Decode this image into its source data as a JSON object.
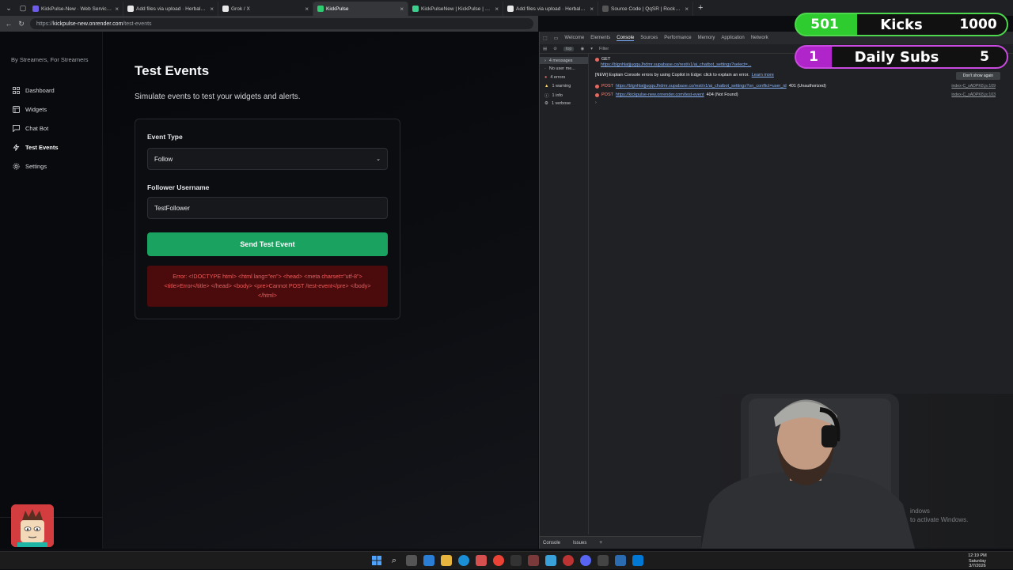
{
  "browser": {
    "tabs": [
      {
        "title": "KickPulse-New · Web Service · Re",
        "favicon_color": "#6c5ce7",
        "active": false
      },
      {
        "title": "Add files via upload · HerbalSalad",
        "favicon_color": "#e8e8e8",
        "active": false
      },
      {
        "title": "Grok / X",
        "favicon_color": "#e8e8e8",
        "active": false
      },
      {
        "title": "KickPulse",
        "favicon_color": "#2ecc71",
        "active": true
      },
      {
        "title": "KickPulseNew | KickPulse | Supaba",
        "favicon_color": "#3ecf8e",
        "active": false
      },
      {
        "title": "Add files via upload · HerbalSalad",
        "favicon_color": "#e8e8e8",
        "active": false
      },
      {
        "title": "Source Code | QqSR | Rocket Ren",
        "favicon_color": "#555555",
        "active": false
      }
    ],
    "url_scheme": "https://",
    "url_host": "kickpulse-new.onrender.com",
    "url_path": "/test-events"
  },
  "sidebar": {
    "tagline": "By Streamers, For Streamers",
    "items": [
      {
        "label": "Dashboard",
        "icon": "dashboard-icon"
      },
      {
        "label": "Widgets",
        "icon": "widgets-icon"
      },
      {
        "label": "Chat Bot",
        "icon": "chat-icon"
      },
      {
        "label": "Test Events",
        "icon": "bolt-icon",
        "active": true
      },
      {
        "label": "Settings",
        "icon": "gear-icon"
      }
    ]
  },
  "main": {
    "title": "Test Events",
    "subtitle": "Simulate events to test your widgets and alerts.",
    "event_type_label": "Event Type",
    "event_type_value": "Follow",
    "username_label": "Follower Username",
    "username_value": "TestFollower",
    "send_label": "Send Test Event",
    "error_text": "Error: <!DOCTYPE html> <html lang=\"en\"> <head> <meta charset=\"utf-8\"> <title>Error</title> </head> <body> <pre>Cannot POST /test-event</pre> </body> </html>"
  },
  "devtools": {
    "tabs": [
      "Welcome",
      "Elements",
      "Console",
      "Sources",
      "Performance",
      "Memory",
      "Application",
      "Network"
    ],
    "selected_tab": "Console",
    "context": "top",
    "filter_placeholder": "Filter",
    "side": [
      {
        "label": "4 messages"
      },
      {
        "label": "No user me..."
      },
      {
        "label": "4 errors"
      },
      {
        "label": "1 warning"
      },
      {
        "label": "1 info"
      },
      {
        "label": "1 verbose"
      }
    ],
    "logs": [
      {
        "method": "GET",
        "url": "https://blgnhlatjjuqquJhdmr.supabase.co/rest/v1/ai_chatbot_settings?select=...",
        "status": "",
        "source": ""
      },
      {
        "method": "",
        "url": "",
        "status": "[NEW] Explain Console errors by using Copilot in Edge: click   to explain an error.",
        "source": ""
      },
      {
        "method": "POST",
        "url": "https://blgnhlatjjuqquJhdmr.supabase.co/rest/v1/ai_chatbot_settings?on_conflict=user_id",
        "status": "401 (Unauthorized)",
        "source": "index-C_sADPK8.js:109"
      },
      {
        "method": "POST",
        "url": "https://kickpulse-new.onrender.com/test-event",
        "status": "404 (Not Found)",
        "source": "index-C_sADPK8.js:103"
      }
    ],
    "learn_more": "Learn more",
    "dont_show": "Don't show again",
    "bottom_tabs": [
      "Console",
      "Issues"
    ]
  },
  "overlays": {
    "kicks_count": "501",
    "kicks_label": "Kicks",
    "kicks_goal": "1000",
    "subs_count": "1",
    "subs_label": "Daily Subs",
    "subs_goal": "5"
  },
  "watermark": {
    "line1": "indows",
    "line2": "to activate Windows."
  },
  "taskbar": {
    "time": "12:19 PM",
    "day": "Saturday",
    "date": "3/7/2026"
  }
}
